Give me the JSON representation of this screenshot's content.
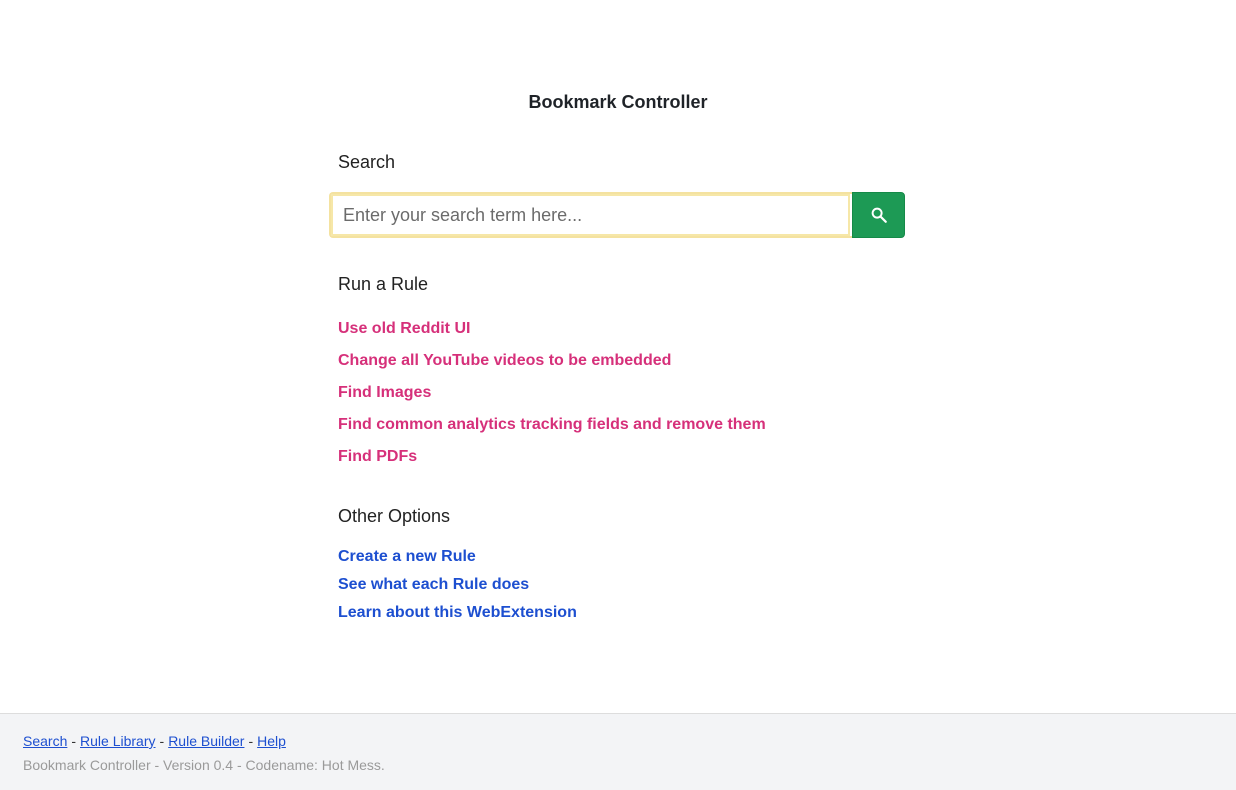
{
  "app": {
    "title": "Bookmark Controller"
  },
  "search": {
    "heading": "Search",
    "placeholder": "Enter your search term here...",
    "value": "",
    "button_icon": "search-icon",
    "button_color": "#1d9a55"
  },
  "rules": {
    "heading": "Run a Rule",
    "items": [
      {
        "label": "Use old Reddit UI"
      },
      {
        "label": "Change all YouTube videos to be embedded"
      },
      {
        "label": "Find Images"
      },
      {
        "label": "Find common analytics tracking fields and remove them"
      },
      {
        "label": "Find PDFs"
      }
    ],
    "link_color": "#d6307a"
  },
  "other_options": {
    "heading": "Other Options",
    "items": [
      {
        "label": "Create a new Rule"
      },
      {
        "label": "See what each Rule does"
      },
      {
        "label": "Learn about this WebExtension"
      }
    ],
    "link_color": "#1d4fd0"
  },
  "footer": {
    "nav": [
      {
        "label": "Search"
      },
      {
        "label": "Rule Library"
      },
      {
        "label": "Rule Builder"
      },
      {
        "label": "Help"
      }
    ],
    "separator": "-",
    "version_text": "Bookmark Controller - Version 0.4 - Codename: Hot Mess."
  }
}
